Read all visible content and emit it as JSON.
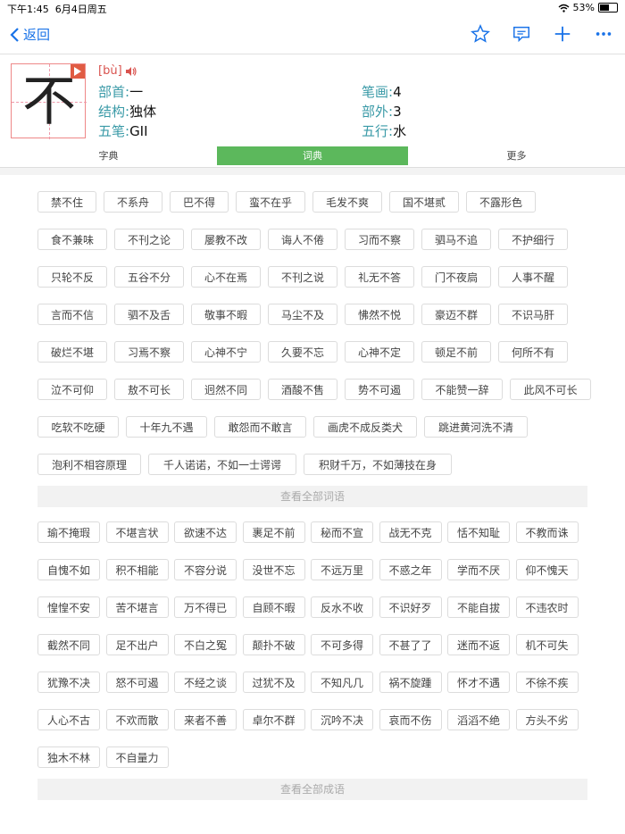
{
  "status": {
    "time": "下午1:45",
    "date": "6月4日周五",
    "battery": "53%",
    "battery_level": 0.53
  },
  "nav": {
    "back_label": "返回"
  },
  "entry": {
    "char": "不",
    "pinyin": "[bù]",
    "radical_label": "部首:",
    "radical_value": "一",
    "strokes_label": "笔画:",
    "strokes_value": "4",
    "structure_label": "结构:",
    "structure_value": "独体",
    "outside_label": "部外:",
    "outside_value": "3",
    "wubi_label": "五笔:",
    "wubi_value": "GII",
    "element_label": "五行:",
    "element_value": "水"
  },
  "tabs": [
    "字典",
    "词典",
    "更多"
  ],
  "words": [
    [
      "禁不住",
      "不系舟",
      "巴不得",
      "蛮不在乎",
      "毛发不爽",
      "国不堪贰",
      "不露形色"
    ],
    [
      "食不兼味",
      "不刊之论",
      "屡教不改",
      "诲人不倦",
      "习而不察",
      "驷马不追",
      "不护细行"
    ],
    [
      "只轮不反",
      "五谷不分",
      "心不在焉",
      "不刊之说",
      "礼无不答",
      "门不夜扃",
      "人事不醒"
    ],
    [
      "言而不信",
      "驷不及舌",
      "敬事不暇",
      "马尘不及",
      "怫然不悦",
      "豪迈不群",
      "不识马肝"
    ],
    [
      "破烂不堪",
      "习焉不察",
      "心神不宁",
      "久要不忘",
      "心神不定",
      "顿足不前",
      "何所不有"
    ],
    [
      "泣不可仰",
      "敖不可长",
      "迥然不同",
      "酒酸不售",
      "势不可遏",
      "不能赞一辞",
      "此风不可长"
    ],
    [
      "吃软不吃硬",
      "十年九不遇",
      "敢怨而不敢言",
      "画虎不成反类犬",
      "跳进黄河洗不清"
    ],
    [
      "泡利不相容原理",
      "千人诺诺，不如一士谔谔",
      "积财千万，不如薄技在身"
    ]
  ],
  "words_viewall": "查看全部词语",
  "idioms": [
    [
      "瑜不掩瑕",
      "不堪言状",
      "欲速不达",
      "裹足不前",
      "秘而不宣",
      "战无不克",
      "恬不知耻",
      "不教而诛"
    ],
    [
      "自愧不如",
      "积不相能",
      "不容分说",
      "没世不忘",
      "不远万里",
      "不惑之年",
      "学而不厌",
      "仰不愧天"
    ],
    [
      "惶惶不安",
      "苦不堪言",
      "万不得已",
      "自顾不暇",
      "反水不收",
      "不识好歹",
      "不能自拔",
      "不违农时"
    ],
    [
      "截然不同",
      "足不出户",
      "不白之冤",
      "颠扑不破",
      "不可多得",
      "不甚了了",
      "迷而不返",
      "机不可失"
    ],
    [
      "犹豫不决",
      "怒不可遏",
      "不经之谈",
      "过犹不及",
      "不知凡几",
      "祸不旋踵",
      "怀才不遇",
      "不徐不疾"
    ],
    [
      "人心不古",
      "不欢而散",
      "来者不善",
      "卓尔不群",
      "沉吟不决",
      "哀而不伤",
      "滔滔不绝",
      "方头不劣"
    ],
    [
      "独木不林",
      "不自量力"
    ]
  ],
  "idioms_viewall": "查看全部成语"
}
